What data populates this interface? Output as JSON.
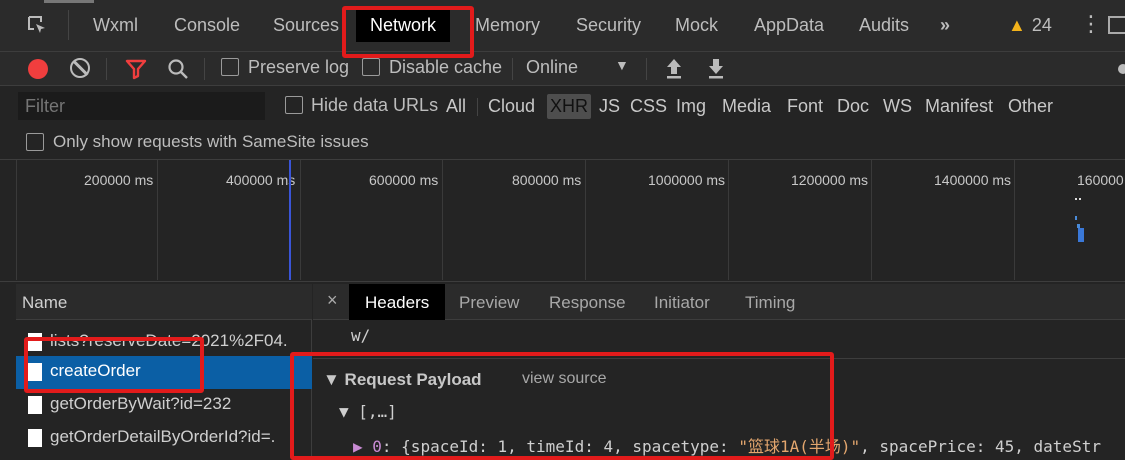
{
  "tabbar": {
    "tabs": [
      "Wxml",
      "Console",
      "Sources",
      "Network",
      "Memory",
      "Security",
      "Mock",
      "AppData",
      "Audits"
    ],
    "active_tab": "Network",
    "more": "»",
    "warning_count": "24"
  },
  "toolbar": {
    "preserve_log": "Preserve log",
    "disable_cache": "Disable cache",
    "throttle": "Online"
  },
  "filter": {
    "placeholder": "Filter",
    "hide_data_urls": "Hide data URLs",
    "types": [
      "All",
      "Cloud",
      "XHR",
      "JS",
      "CSS",
      "Img",
      "Media",
      "Font",
      "Doc",
      "WS",
      "Manifest",
      "Other"
    ],
    "active_type": "XHR"
  },
  "samesite": {
    "label": "Only show requests with SameSite issues"
  },
  "timeline": {
    "ticks": [
      "200000 ms",
      "400000 ms",
      "600000 ms",
      "800000 ms",
      "1000000 ms",
      "1200000 ms",
      "1400000 ms",
      "160000"
    ]
  },
  "requests": {
    "header": "Name",
    "items": [
      "lists?reserveDate=2021%2F04.",
      "createOrder",
      "getOrderByWait?id=232",
      "getOrderDetailByOrderId?id=."
    ],
    "selected": "createOrder"
  },
  "detail": {
    "close": "×",
    "tabs": [
      "Headers",
      "Preview",
      "Response",
      "Initiator",
      "Timing"
    ],
    "active_tab": "Headers",
    "line_w": "w/",
    "payload_title": "▼ Request Payload",
    "view_source": "view source",
    "array_line": "▼ [,…]",
    "item0": {
      "index": "▶ 0",
      "text_a": ": {spaceId: 1, timeId: 4, spacetype: ",
      "string": "\"篮球1A(半场)\"",
      "text_b": ", spacePrice: 45, dateStr"
    }
  },
  "colors": {
    "accent_red": "#e21b1b",
    "selected_row": "#0b5fa5",
    "record": "#f03e3e",
    "warning": "#f3b31b"
  }
}
